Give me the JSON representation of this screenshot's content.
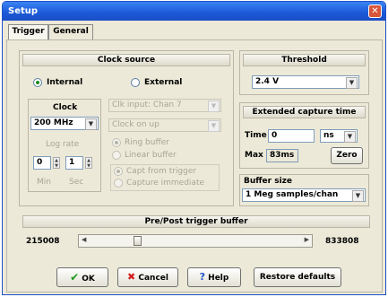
{
  "window": {
    "title": "Setup",
    "close_glyph": "✕"
  },
  "tabs": [
    {
      "label": "Trigger",
      "active": true
    },
    {
      "label": "General",
      "active": false
    }
  ],
  "clock_source": {
    "header": "Clock source",
    "internal_label": "Internal",
    "external_label": "External",
    "selected": "Internal",
    "clock_label": "Clock",
    "clock_value": "200 MHz",
    "log_rate_label": "Log rate",
    "min_value": "0",
    "sec_value": "1",
    "min_label": "Min",
    "sec_label": "Sec",
    "clk_input_value": "Clk input: Chan 7",
    "clock_edge_value": "Clock on up",
    "ring_buffer_label": "Ring buffer",
    "linear_buffer_label": "Linear buffer",
    "capt_from_trigger_label": "Capt from trigger",
    "capture_immediate_label": "Capture immediate"
  },
  "threshold": {
    "header": "Threshold",
    "value": "2.4 V"
  },
  "extended_capture": {
    "header": "Extended capture time",
    "time_label": "Time",
    "time_value": "0",
    "unit_value": "ns",
    "max_label": "Max",
    "max_value": "83ms",
    "zero_label": "Zero"
  },
  "buffer_size": {
    "label": "Buffer size",
    "value": "1 Meg samples/chan"
  },
  "pre_post": {
    "header": "Pre/Post trigger buffer",
    "left_value": "215008",
    "right_value": "833808",
    "slider_fraction": 0.21
  },
  "buttons": {
    "ok": "OK",
    "cancel": "Cancel",
    "help": "Help",
    "restore": "Restore defaults"
  },
  "colors": {
    "titlebar": "#1b58d8",
    "ok_check": "#1f9a1f",
    "cancel_x": "#d21e1e",
    "help_q": "#2356c8",
    "dialog_bg": "#ece9d8"
  },
  "icons": {
    "ok": "check-icon",
    "cancel": "x-icon",
    "help": "question-icon",
    "close": "close-icon"
  }
}
